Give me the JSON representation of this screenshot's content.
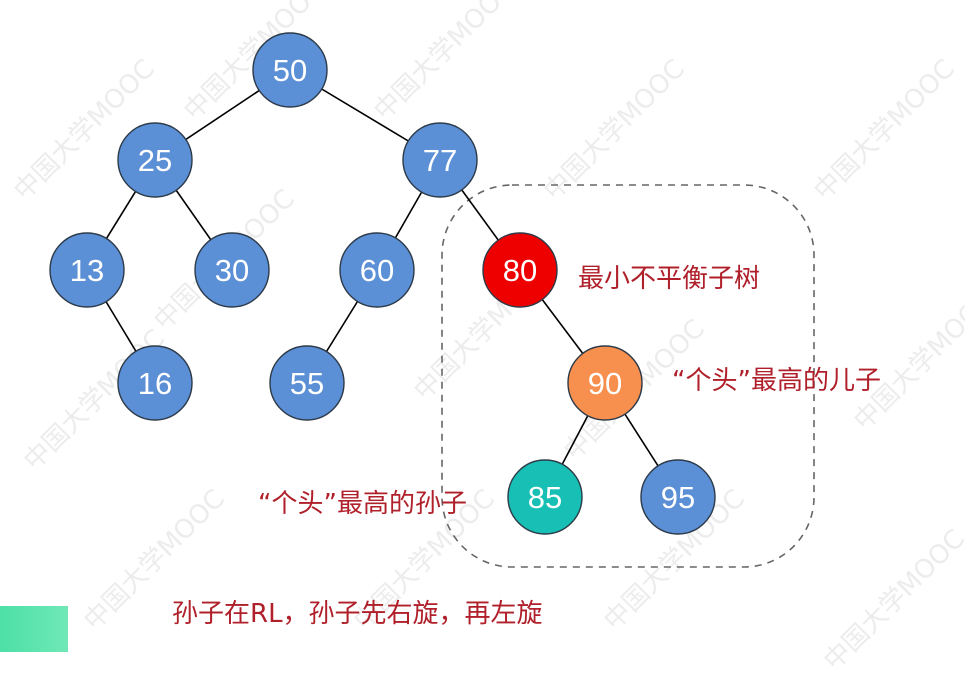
{
  "watermark": "中国大学MOOC",
  "tree": {
    "nodes": [
      {
        "id": "n50",
        "value": "50",
        "role": "normal"
      },
      {
        "id": "n25",
        "value": "25",
        "role": "normal"
      },
      {
        "id": "n77",
        "value": "77",
        "role": "normal"
      },
      {
        "id": "n13",
        "value": "13",
        "role": "normal"
      },
      {
        "id": "n30",
        "value": "30",
        "role": "normal"
      },
      {
        "id": "n60",
        "value": "60",
        "role": "normal"
      },
      {
        "id": "n80",
        "value": "80",
        "role": "unbalanced"
      },
      {
        "id": "n16",
        "value": "16",
        "role": "normal"
      },
      {
        "id": "n55",
        "value": "55",
        "role": "normal"
      },
      {
        "id": "n90",
        "value": "90",
        "role": "child"
      },
      {
        "id": "n85",
        "value": "85",
        "role": "grandchild"
      },
      {
        "id": "n95",
        "value": "95",
        "role": "normal"
      }
    ],
    "edges": [
      [
        "n50",
        "n25"
      ],
      [
        "n50",
        "n77"
      ],
      [
        "n25",
        "n13"
      ],
      [
        "n25",
        "n30"
      ],
      [
        "n13",
        "n16"
      ],
      [
        "n77",
        "n60"
      ],
      [
        "n77",
        "n80"
      ],
      [
        "n60",
        "n55"
      ],
      [
        "n80",
        "n90"
      ],
      [
        "n90",
        "n85"
      ],
      [
        "n90",
        "n95"
      ]
    ]
  },
  "colors": {
    "normal": "#5b8fd6",
    "unbalanced": "#ee0000",
    "child": "#f7904f",
    "grandchild": "#17bfb4",
    "node_stroke": "#2d3a48",
    "label_text": "#b0202a",
    "dashed_box": "#666666"
  },
  "labels": {
    "min_unbalanced_subtree": "最小不平衡子树",
    "tallest_child": "“个头”最高的儿子",
    "tallest_grandchild": "“个头”最高的孙子",
    "caption": "孙子在RL，孙子先右旋，再左旋"
  }
}
